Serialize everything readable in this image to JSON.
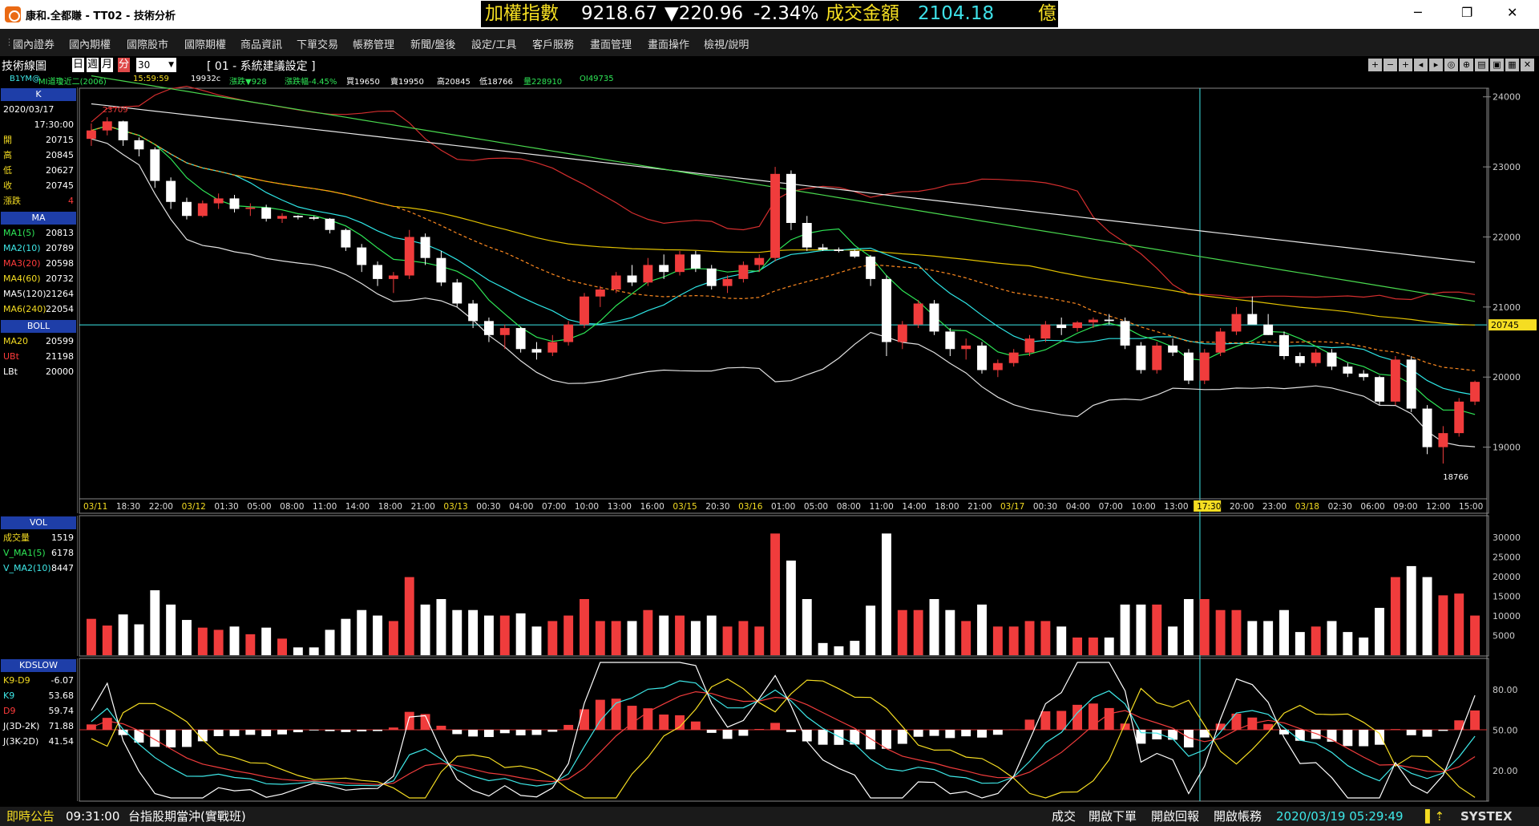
{
  "window": {
    "title": "康和.全都賺 - TT02 - 技術分析"
  },
  "ticker": {
    "name": "加權指數",
    "value": "9218.67",
    "change": "▼220.96",
    "pct": "-2.34%",
    "vol_label": "成交金額",
    "vol_value": "2104.18",
    "unit": "億"
  },
  "menu": [
    "國內證券",
    "國內期權",
    "國際股市",
    "國際期權",
    "商品資訊",
    "下單交易",
    "帳務管理",
    "新聞/盤後",
    "設定/工具",
    "客戶服務",
    "畫面管理",
    "畫面操作",
    "檢視/說明"
  ],
  "chartbar": {
    "label": "技術線圖",
    "periods": [
      "日",
      "週",
      "月",
      "分"
    ],
    "active_period": "分",
    "interval": "30",
    "settings": "[ 01 - 系統建議設定 ]"
  },
  "quote": {
    "symbol": "B1YM@",
    "name": "MI道瓊近二(2006)",
    "time": "15:59:59",
    "price": "19932c",
    "chg": "漲跌▼928",
    "pct": "漲跌幅-4.45%",
    "buy": "買19650",
    "sell": "賣19950",
    "high": "高20845",
    "low": "低18766",
    "vol": "量228910",
    "oi": "OI49735"
  },
  "panels": {
    "k": {
      "title": "K",
      "date": "2020/03/17",
      "time": "17:30:00",
      "rows": [
        [
          "開",
          "20715"
        ],
        [
          "高",
          "20845"
        ],
        [
          "低",
          "20627"
        ],
        [
          "收",
          "20745"
        ],
        [
          "漲跌",
          "4"
        ]
      ]
    },
    "ma": {
      "title": "MA",
      "rows": [
        [
          "MA1(5)",
          "20813"
        ],
        [
          "MA2(10)",
          "20789"
        ],
        [
          "MA3(20)",
          "20598"
        ],
        [
          "MA4(60)",
          "20732"
        ],
        [
          "MA5(120)",
          "21264"
        ],
        [
          "MA6(240)",
          "22054"
        ]
      ]
    },
    "boll": {
      "title": "BOLL",
      "rows": [
        [
          "MA20",
          "20599"
        ],
        [
          "UBt",
          "21198"
        ],
        [
          "LBt",
          "20000"
        ]
      ]
    },
    "vol": {
      "title": "VOL",
      "rows": [
        [
          "成交量",
          "1519"
        ],
        [
          "V_MA1(5)",
          "6178"
        ],
        [
          "V_MA2(10)",
          "8447"
        ]
      ]
    },
    "kd": {
      "title": "KDSLOW",
      "rows": [
        [
          "K9-D9",
          "-6.07"
        ],
        [
          "K9",
          "53.68"
        ],
        [
          "D9",
          "59.74"
        ],
        [
          "J(3D-2K)",
          "71.88"
        ],
        [
          "J(3K-2D)",
          "41.54"
        ]
      ]
    }
  },
  "axes": {
    "price_ticks": [
      "24000",
      "23000",
      "22000",
      "21000",
      "20000",
      "19000"
    ],
    "vol_ticks": [
      "30000",
      "25000",
      "20000",
      "15000",
      "10000",
      "5000"
    ],
    "kd_ticks": [
      "80.00",
      "50.00",
      "20.00"
    ],
    "current_price": "20745",
    "time_labels": [
      {
        "t": "03/11",
        "y": true
      },
      {
        "t": "18:30"
      },
      {
        "t": "22:00"
      },
      {
        "t": "03/12",
        "y": true
      },
      {
        "t": "01:30"
      },
      {
        "t": "05:00"
      },
      {
        "t": "08:00"
      },
      {
        "t": "11:00"
      },
      {
        "t": "14:00"
      },
      {
        "t": "18:00"
      },
      {
        "t": "21:00"
      },
      {
        "t": "03/13",
        "y": true
      },
      {
        "t": "00:30"
      },
      {
        "t": "04:00"
      },
      {
        "t": "07:00"
      },
      {
        "t": "10:00"
      },
      {
        "t": "13:00"
      },
      {
        "t": "16:00"
      },
      {
        "t": "03/15",
        "y": true
      },
      {
        "t": "20:30"
      },
      {
        "t": "03/16",
        "y": true
      },
      {
        "t": "01:00"
      },
      {
        "t": "05:00"
      },
      {
        "t": "08:00"
      },
      {
        "t": "11:00"
      },
      {
        "t": "14:00"
      },
      {
        "t": "18:00"
      },
      {
        "t": "21:00"
      },
      {
        "t": "03/17",
        "y": true
      },
      {
        "t": "00:30"
      },
      {
        "t": "04:00"
      },
      {
        "t": "07:00"
      },
      {
        "t": "10:00"
      },
      {
        "t": "13:00"
      },
      {
        "t": "17:30",
        "hl": true
      },
      {
        "t": "20:00"
      },
      {
        "t": "23:00"
      },
      {
        "t": "03/18",
        "y": true
      },
      {
        "t": "02:30"
      },
      {
        "t": "06:00"
      },
      {
        "t": "09:00"
      },
      {
        "t": "12:00"
      },
      {
        "t": "15:00"
      }
    ],
    "hi_label": "23709",
    "lo_label": "18766"
  },
  "chart_data": {
    "type": "candlestick",
    "interval": "30 min",
    "ylim": [
      18400,
      24100
    ],
    "ohlc": [
      [
        23400,
        23620,
        23300,
        23520
      ],
      [
        23520,
        23709,
        23450,
        23650
      ],
      [
        23650,
        23660,
        23300,
        23380
      ],
      [
        23380,
        23420,
        23150,
        23250
      ],
      [
        23250,
        23280,
        22700,
        22800
      ],
      [
        22800,
        22850,
        22400,
        22500
      ],
      [
        22500,
        22560,
        22250,
        22300
      ],
      [
        22300,
        22520,
        22280,
        22480
      ],
      [
        22480,
        22620,
        22400,
        22550
      ],
      [
        22550,
        22600,
        22350,
        22400
      ],
      [
        22400,
        22480,
        22300,
        22420
      ],
      [
        22420,
        22460,
        22220,
        22260
      ],
      [
        22260,
        22340,
        22200,
        22300
      ],
      [
        22300,
        22310,
        22250,
        22280
      ],
      [
        22280,
        22300,
        22240,
        22260
      ],
      [
        22260,
        22270,
        22050,
        22100
      ],
      [
        22100,
        22120,
        21800,
        21850
      ],
      [
        21850,
        21900,
        21500,
        21600
      ],
      [
        21600,
        21650,
        21300,
        21400
      ],
      [
        21400,
        21500,
        21200,
        21450
      ],
      [
        21450,
        22100,
        21400,
        22000
      ],
      [
        22000,
        22050,
        21600,
        21700
      ],
      [
        21700,
        21800,
        21300,
        21350
      ],
      [
        21350,
        21400,
        21000,
        21050
      ],
      [
        21050,
        21100,
        20700,
        20800
      ],
      [
        20800,
        20850,
        20500,
        20600
      ],
      [
        20600,
        20750,
        20400,
        20700
      ],
      [
        20700,
        20720,
        20350,
        20400
      ],
      [
        20400,
        20500,
        20250,
        20350
      ],
      [
        20350,
        20600,
        20300,
        20500
      ],
      [
        20500,
        20800,
        20450,
        20750
      ],
      [
        20750,
        21200,
        20700,
        21150
      ],
      [
        21150,
        21300,
        21000,
        21250
      ],
      [
        21250,
        21500,
        21200,
        21450
      ],
      [
        21450,
        21600,
        21300,
        21350
      ],
      [
        21350,
        21700,
        21300,
        21600
      ],
      [
        21600,
        21750,
        21400,
        21500
      ],
      [
        21500,
        21800,
        21450,
        21750
      ],
      [
        21750,
        21800,
        21500,
        21550
      ],
      [
        21550,
        21600,
        21250,
        21300
      ],
      [
        21300,
        21450,
        21200,
        21400
      ],
      [
        21400,
        21650,
        21350,
        21600
      ],
      [
        21600,
        21750,
        21500,
        21700
      ],
      [
        21700,
        23000,
        21650,
        22900
      ],
      [
        22900,
        22950,
        22100,
        22200
      ],
      [
        22200,
        22300,
        21800,
        21850
      ],
      [
        21850,
        21900,
        21800,
        21820
      ],
      [
        21820,
        21850,
        21780,
        21800
      ],
      [
        21800,
        21820,
        21700,
        21720
      ],
      [
        21720,
        21740,
        21300,
        21400
      ],
      [
        21400,
        21450,
        20300,
        20500
      ],
      [
        20500,
        20800,
        20400,
        20750
      ],
      [
        20750,
        21100,
        20700,
        21050
      ],
      [
        21050,
        21100,
        20600,
        20650
      ],
      [
        20650,
        20700,
        20300,
        20400
      ],
      [
        20400,
        20550,
        20250,
        20450
      ],
      [
        20450,
        20500,
        20050,
        20100
      ],
      [
        20100,
        20250,
        20000,
        20200
      ],
      [
        20200,
        20400,
        20150,
        20350
      ],
      [
        20350,
        20600,
        20300,
        20550
      ],
      [
        20550,
        20800,
        20500,
        20750
      ],
      [
        20750,
        20850,
        20600,
        20700
      ],
      [
        20700,
        20800,
        20650,
        20780
      ],
      [
        20780,
        20850,
        20700,
        20820
      ],
      [
        20820,
        20900,
        20750,
        20800
      ],
      [
        20800,
        20850,
        20400,
        20450
      ],
      [
        20450,
        20500,
        20050,
        20100
      ],
      [
        20100,
        20500,
        20050,
        20450
      ],
      [
        20450,
        20550,
        20300,
        20350
      ],
      [
        20350,
        20400,
        19900,
        19950
      ],
      [
        19950,
        20400,
        19900,
        20350
      ],
      [
        20350,
        20700,
        20300,
        20650
      ],
      [
        20650,
        21000,
        20600,
        20900
      ],
      [
        20900,
        21150,
        20850,
        20750
      ],
      [
        20750,
        20900,
        20600,
        20600
      ],
      [
        20600,
        20650,
        20250,
        20300
      ],
      [
        20300,
        20350,
        20150,
        20200
      ],
      [
        20200,
        20400,
        20150,
        20350
      ],
      [
        20350,
        20400,
        20100,
        20150
      ],
      [
        20150,
        20200,
        20000,
        20050
      ],
      [
        20050,
        20100,
        19950,
        20000
      ],
      [
        20000,
        20020,
        19600,
        19650
      ],
      [
        19650,
        20300,
        19600,
        20250
      ],
      [
        20250,
        20300,
        19500,
        19550
      ],
      [
        19550,
        19600,
        18900,
        19000
      ],
      [
        19000,
        19300,
        18766,
        19200
      ],
      [
        19200,
        19700,
        19150,
        19650
      ],
      [
        19650,
        19950,
        19600,
        19932
      ]
    ]
  }
}
